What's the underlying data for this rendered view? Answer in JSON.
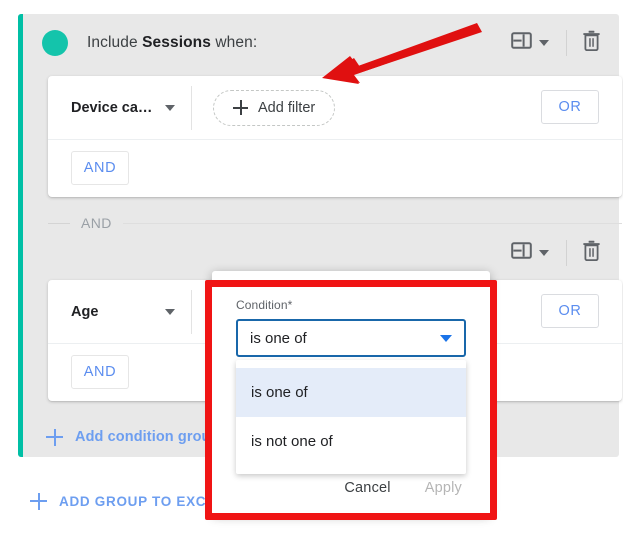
{
  "include_group": {
    "header": {
      "prefix": "Include ",
      "scope": "Sessions",
      "suffix": " when:",
      "status_dot": "status-dot",
      "layout_icon": "table-layout-icon",
      "dropdown_icon": "chevron-down-icon",
      "delete_icon": "trash-icon",
      "accent_color": "#00bfa5"
    },
    "conditions": [
      {
        "dimension": "Device ca…",
        "add_filter_label": "Add filter",
        "or_label": "OR",
        "and_label": "AND"
      },
      {
        "dimension": "Age",
        "or_label": "OR",
        "and_label": "AND"
      }
    ],
    "group_joiner": "AND",
    "add_condition_group_label": "Add condition group"
  },
  "add_group_to_exclude_label": "ADD GROUP TO EXCLUDE",
  "condition_popover": {
    "field_label": "Condition*",
    "selected_value": "is one of",
    "options": [
      {
        "label": "is one of",
        "selected": true
      },
      {
        "label": "is not one of",
        "selected": false
      }
    ],
    "cancel_label": "Cancel",
    "apply_label": "Apply",
    "select_border_color": "#1967aa",
    "option_highlight_color": "#e4ecf9"
  },
  "annotations": {
    "arrow_color": "#e01010",
    "box_color": "#f01414",
    "arrow_name": "red-pointer-arrow",
    "box_name": "red-highlight-box"
  }
}
